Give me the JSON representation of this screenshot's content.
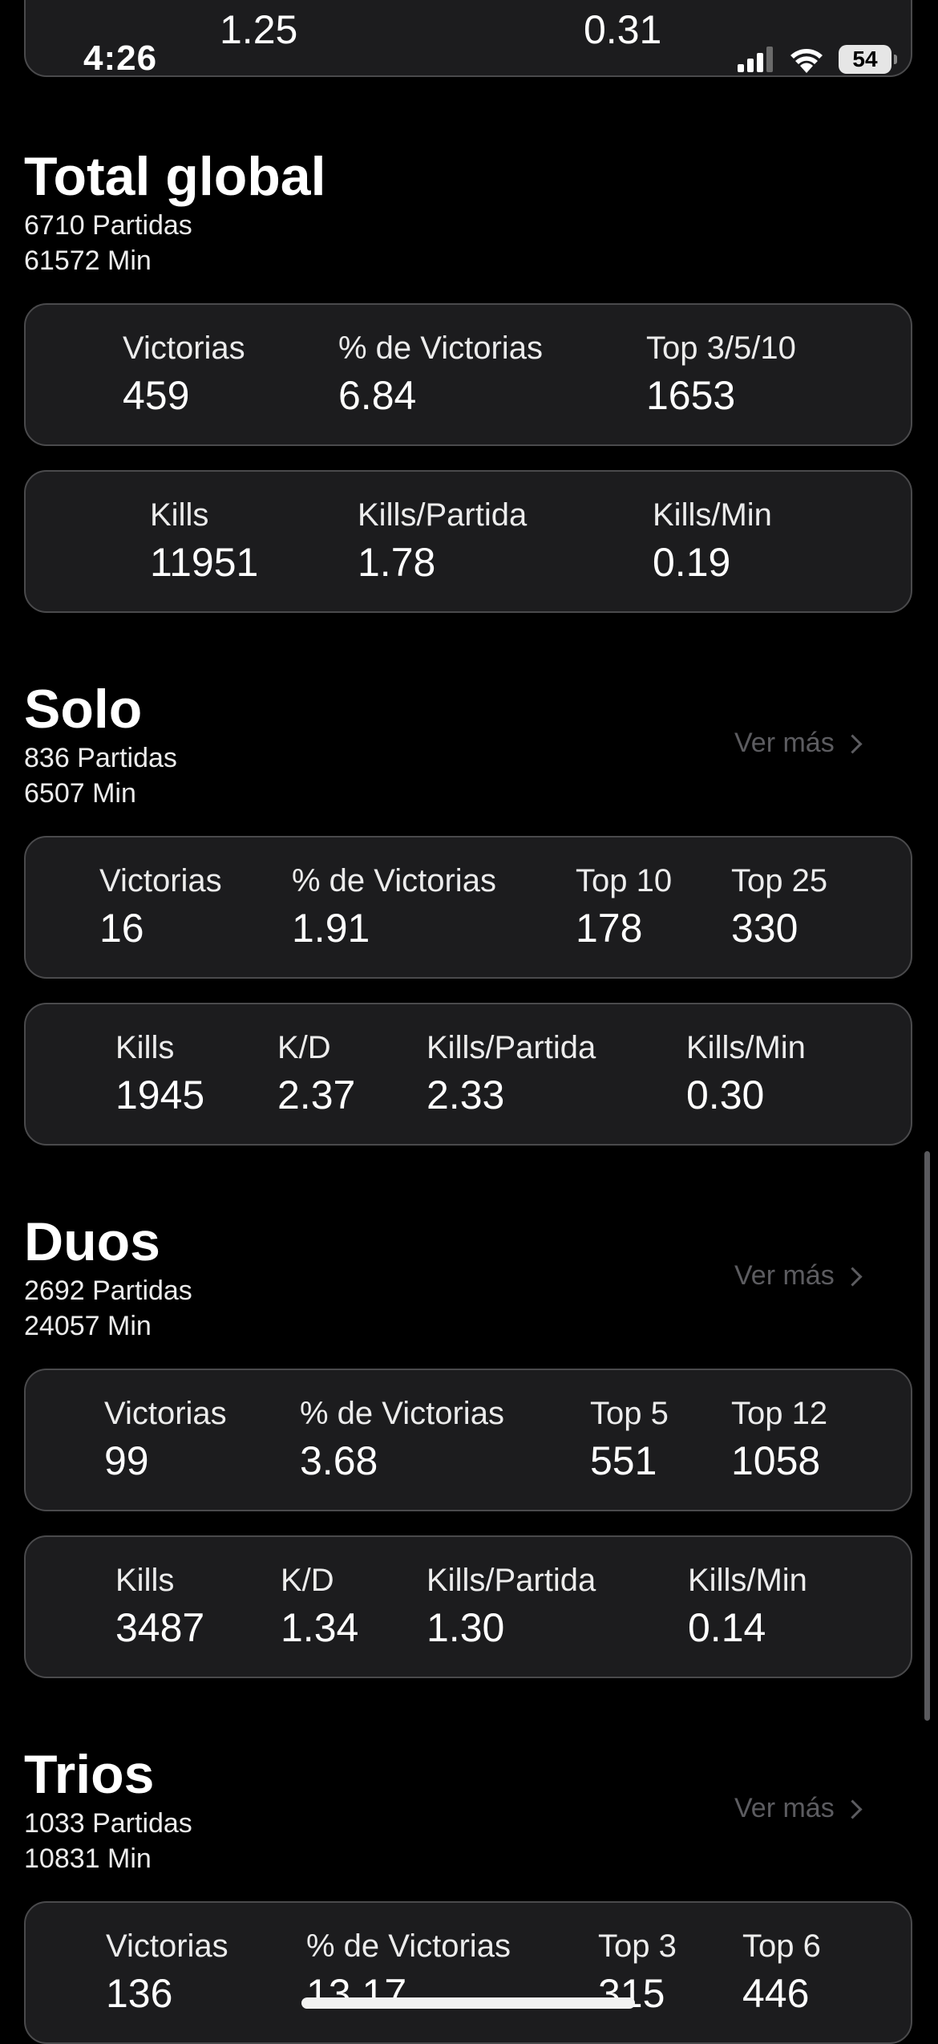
{
  "status_bar": {
    "time": "4:26",
    "battery": "54",
    "icons": [
      "cellular-signal-icon",
      "wifi-icon",
      "battery-icon"
    ]
  },
  "top_card": {
    "values": [
      "1.25",
      "0.31"
    ]
  },
  "total_global": {
    "title": "Total global",
    "partidas": "6710 Partidas",
    "minutes": "61572 Min",
    "row1": [
      {
        "label": "Victorias",
        "value": "459"
      },
      {
        "label": "% de Victorias",
        "value": "6.84"
      },
      {
        "label": "Top 3/5/10",
        "value": "1653"
      }
    ],
    "row2": [
      {
        "label": "Kills",
        "value": "11951"
      },
      {
        "label": "Kills/Partida",
        "value": "1.78"
      },
      {
        "label": "Kills/Min",
        "value": "0.19"
      }
    ]
  },
  "solo": {
    "title": "Solo",
    "partidas": "836 Partidas",
    "minutes": "6507 Min",
    "ver_mas": "Ver más",
    "row1": [
      {
        "label": "Victorias",
        "value": "16"
      },
      {
        "label": "% de Victorias",
        "value": "1.91"
      },
      {
        "label": "Top 10",
        "value": "178"
      },
      {
        "label": "Top 25",
        "value": "330"
      }
    ],
    "row2": [
      {
        "label": "Kills",
        "value": "1945"
      },
      {
        "label": "K/D",
        "value": "2.37"
      },
      {
        "label": "Kills/Partida",
        "value": "2.33"
      },
      {
        "label": "Kills/Min",
        "value": "0.30"
      }
    ]
  },
  "duos": {
    "title": "Duos",
    "partidas": "2692 Partidas",
    "minutes": "24057 Min",
    "ver_mas": "Ver más",
    "row1": [
      {
        "label": "Victorias",
        "value": "99"
      },
      {
        "label": "% de Victorias",
        "value": "3.68"
      },
      {
        "label": "Top 5",
        "value": "551"
      },
      {
        "label": "Top 12",
        "value": "1058"
      }
    ],
    "row2": [
      {
        "label": "Kills",
        "value": "3487"
      },
      {
        "label": "K/D",
        "value": "1.34"
      },
      {
        "label": "Kills/Partida",
        "value": "1.30"
      },
      {
        "label": "Kills/Min",
        "value": "0.14"
      }
    ]
  },
  "trios": {
    "title": "Trios",
    "partidas": "1033 Partidas",
    "minutes": "10831 Min",
    "ver_mas": "Ver más",
    "row1": [
      {
        "label": "Victorias",
        "value": "136"
      },
      {
        "label": "% de Victorias",
        "value": "13.17"
      },
      {
        "label": "Top 3",
        "value": "315"
      },
      {
        "label": "Top 6",
        "value": "446"
      }
    ]
  },
  "colors": {
    "background": "#000000",
    "card": "#1c1c1e",
    "card_border": "#4a4a4c",
    "link": "#5c5c60"
  }
}
